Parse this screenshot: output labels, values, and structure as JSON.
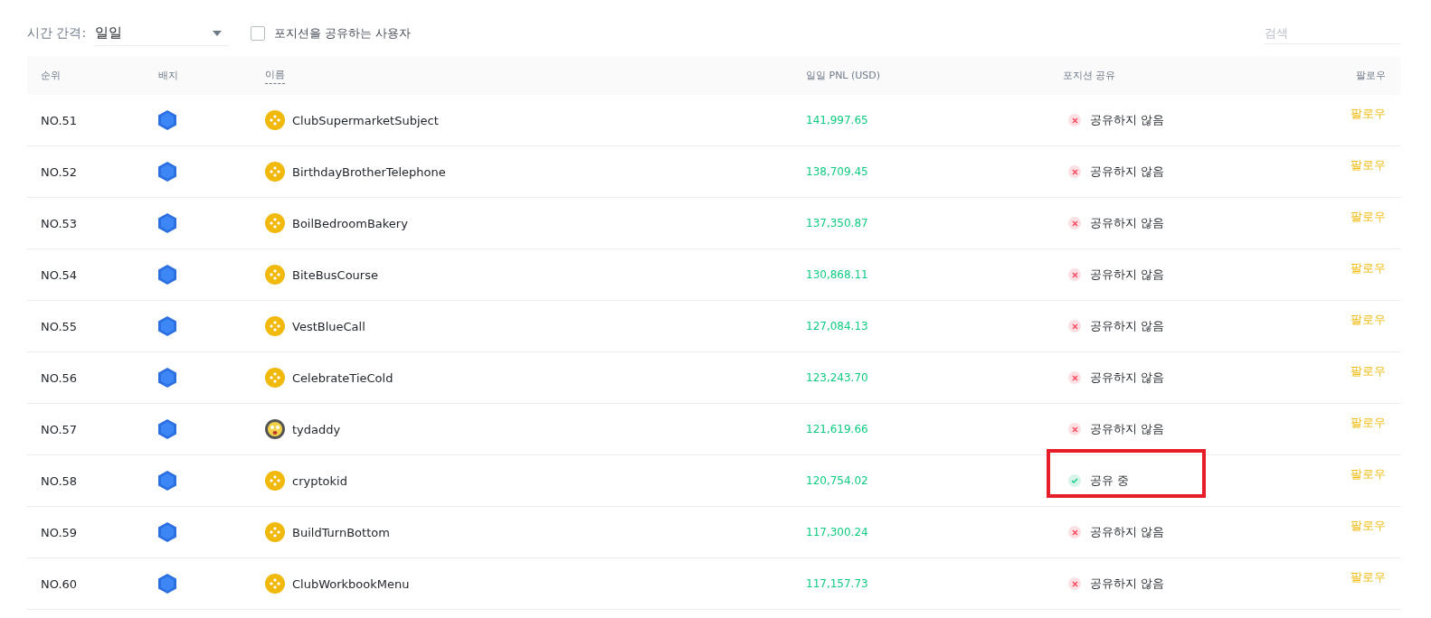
{
  "filters": {
    "interval_label": "시간 간격:",
    "interval_value": "일일",
    "share_filter": {
      "label": "포지션을 공유하는 사용자",
      "checked": false
    },
    "search": {
      "placeholder": "검색"
    }
  },
  "table": {
    "columns": [
      "순위",
      "배지",
      "이름",
      "일일 PNL (USD)",
      "포지션 공유",
      "팔로우"
    ],
    "rows": [
      {
        "rank": "NO.51",
        "kind": "coin",
        "name": "ClubSupermarketSubject",
        "pnl": "141,997.65",
        "sharing": false,
        "share_text": "공유하지 않음",
        "follow": "팔로우",
        "highlighted": false
      },
      {
        "rank": "NO.52",
        "kind": "coin",
        "name": "BirthdayBrotherTelephone",
        "pnl": "138,709.45",
        "sharing": false,
        "share_text": "공유하지 않음",
        "follow": "팔로우",
        "highlighted": false
      },
      {
        "rank": "NO.53",
        "kind": "coin",
        "name": "BoilBedroomBakery",
        "pnl": "137,350.87",
        "sharing": false,
        "share_text": "공유하지 않음",
        "follow": "팔로우",
        "highlighted": false
      },
      {
        "rank": "NO.54",
        "kind": "coin",
        "name": "BiteBusCourse",
        "pnl": "130,868.11",
        "sharing": false,
        "share_text": "공유하지 않음",
        "follow": "팔로우",
        "highlighted": false
      },
      {
        "rank": "NO.55",
        "kind": "coin",
        "name": "VestBlueCall",
        "pnl": "127,084.13",
        "sharing": false,
        "share_text": "공유하지 않음",
        "follow": "팔로우",
        "highlighted": false
      },
      {
        "rank": "NO.56",
        "kind": "coin",
        "name": "CelebrateTieCold",
        "pnl": "123,243.70",
        "sharing": false,
        "share_text": "공유하지 않음",
        "follow": "팔로우",
        "highlighted": false
      },
      {
        "rank": "NO.57",
        "kind": "face",
        "name": "tydaddy",
        "pnl": "121,619.66",
        "sharing": false,
        "share_text": "공유하지 않음",
        "follow": "팔로우",
        "highlighted": false
      },
      {
        "rank": "NO.58",
        "kind": "coin",
        "name": "cryptokid",
        "pnl": "120,754.02",
        "sharing": true,
        "share_text": "공유 중",
        "follow": "팔로우",
        "highlighted": true
      },
      {
        "rank": "NO.59",
        "kind": "coin",
        "name": "BuildTurnBottom",
        "pnl": "117,300.24",
        "sharing": false,
        "share_text": "공유하지 않음",
        "follow": "팔로우",
        "highlighted": false
      },
      {
        "rank": "NO.60",
        "kind": "coin",
        "name": "ClubWorkbookMenu",
        "pnl": "117,157.73",
        "sharing": false,
        "share_text": "공유하지 않음",
        "follow": "팔로우",
        "highlighted": false
      }
    ]
  }
}
